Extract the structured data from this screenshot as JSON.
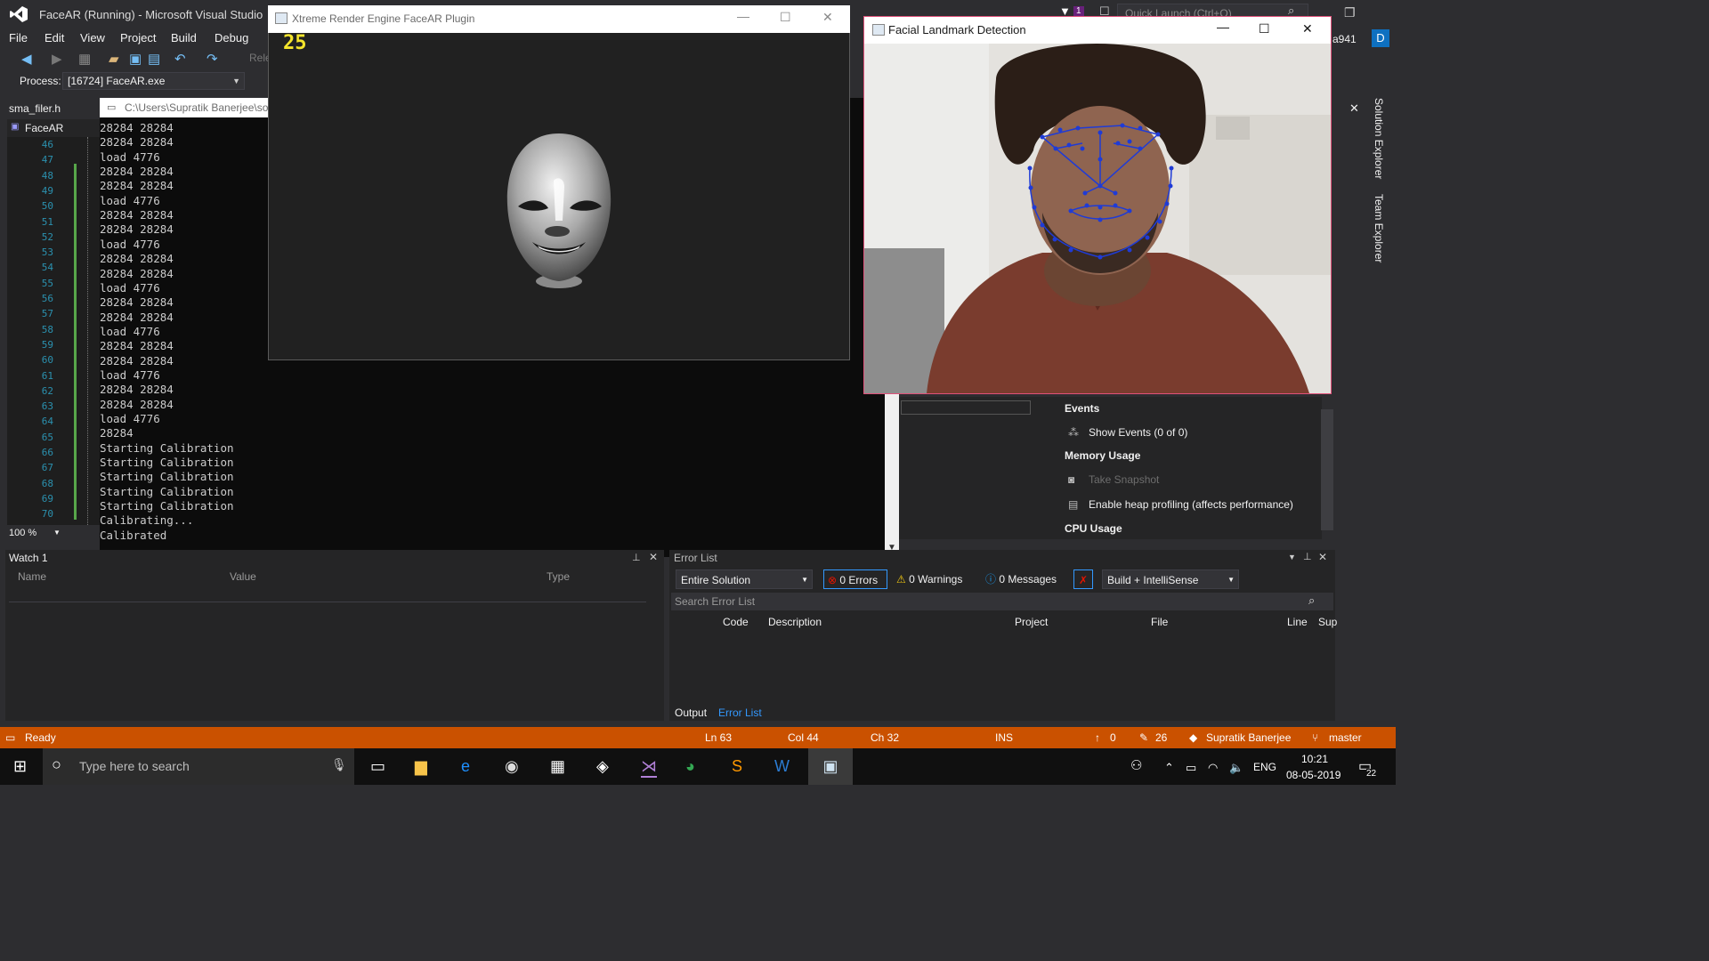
{
  "vs": {
    "title": "FaceAR (Running) - Microsoft Visual Studio",
    "quick_launch_placeholder": "Quick Launch (Ctrl+Q)",
    "notification_count": "1",
    "user_suffix": "a941",
    "user_initial": "D",
    "menu": [
      "File",
      "Edit",
      "View",
      "Project",
      "Build",
      "Debug"
    ],
    "toolbar_rel": "Rele",
    "process_label": "Process:",
    "process_value": "[16724] FaceAR.exe",
    "doc_tab": "sma_filer.h",
    "nav_project": "FaceAR",
    "zoom": "100 %",
    "line_numbers": [
      "46",
      "47",
      "48",
      "49",
      "50",
      "51",
      "52",
      "53",
      "54",
      "55",
      "56",
      "57",
      "58",
      "59",
      "60",
      "61",
      "62",
      "63",
      "64",
      "65",
      "66",
      "67",
      "68",
      "69",
      "70"
    ]
  },
  "console": {
    "title": "C:\\Users\\Supratik Banerjee\\so",
    "lines": [
      "28284 28284",
      "28284 28284",
      "load 4776",
      "28284 28284",
      "28284 28284",
      "load 4776",
      "28284 28284",
      "28284 28284",
      "load 4776",
      "28284 28284",
      "28284 28284",
      "load 4776",
      "28284 28284",
      "28284 28284",
      "load 4776",
      "28284 28284",
      "28284 28284",
      "load 4776",
      "28284 28284",
      "28284 28284",
      "load 4776",
      "28284",
      "Starting Calibration",
      "Starting Calibration",
      "Starting Calibration",
      "Starting Calibration",
      "Starting Calibration",
      "Calibrating...",
      "Calibrated"
    ]
  },
  "render_window": {
    "title": "Xtreme Render Engine FaceAR Plugin",
    "fps": "25"
  },
  "face_window": {
    "title": "Facial Landmark Detection"
  },
  "diagnostics": {
    "events_header": "Events",
    "show_events": "Show Events (0 of 0)",
    "memory_header": "Memory Usage",
    "take_snapshot": "Take Snapshot",
    "heap_profiling": "Enable heap profiling (affects performance)",
    "cpu_header": "CPU Usage"
  },
  "watch": {
    "title": "Watch 1",
    "columns": [
      "Name",
      "Value",
      "Type"
    ]
  },
  "error_list": {
    "title": "Error List",
    "scope": "Entire Solution",
    "errors": "0 Errors",
    "warnings": "0 Warnings",
    "messages": "0 Messages",
    "build_filter": "Build + IntelliSense",
    "search_placeholder": "Search Error List",
    "columns": [
      "Code",
      "Description",
      "Project",
      "File",
      "Line",
      "Sup"
    ],
    "tabs": [
      "Output",
      "Error List"
    ]
  },
  "side_tabs": [
    "Solution Explorer",
    "Team Explorer"
  ],
  "statusbar": {
    "ready": "Ready",
    "ln": "Ln 63",
    "col": "Col 44",
    "ch": "Ch 32",
    "ins": "INS",
    "up_count": "0",
    "pencil_count": "26",
    "user": "Supratik Banerjee",
    "branch": "master"
  },
  "taskbar": {
    "search_placeholder": "Type here to search",
    "language": "ENG",
    "time": "10:21",
    "date": "08-05-2019",
    "notifications": "22"
  },
  "colors": {
    "status_orange": "#ca5100",
    "vs_dark": "#2d2d30",
    "landmark_blue": "#1f3bd6",
    "fps_yellow": "#f5e52c"
  }
}
